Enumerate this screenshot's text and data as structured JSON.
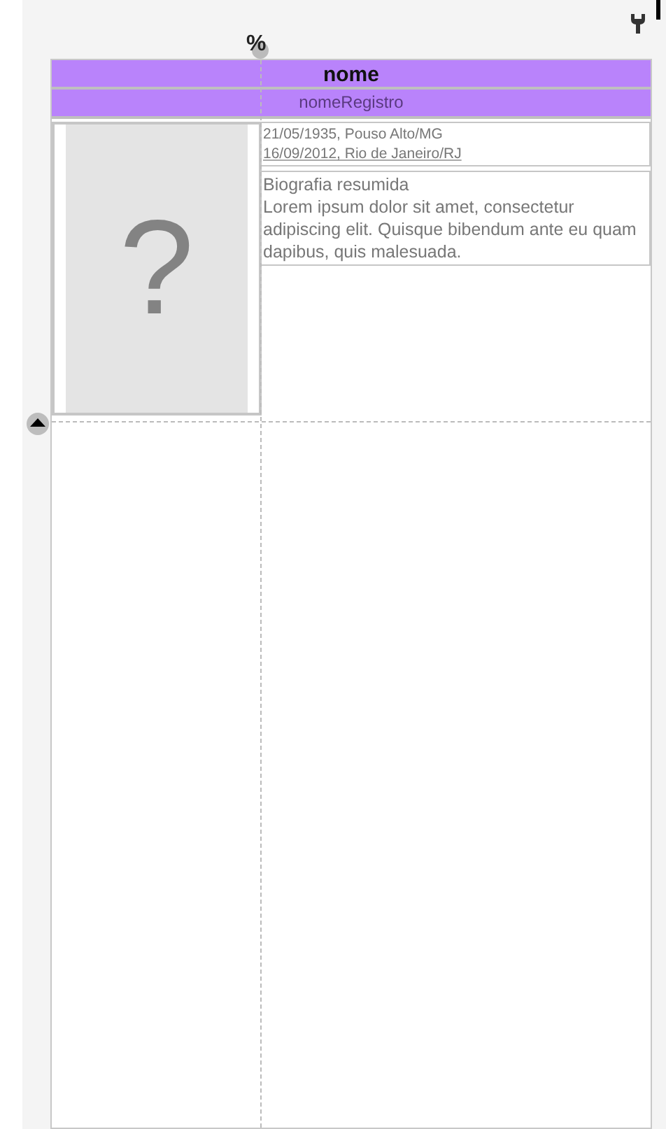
{
  "toolbar": {
    "percent_label": "%"
  },
  "header": {
    "title": "nome",
    "subtitle": "nomeRegistro"
  },
  "photo": {
    "placeholder_symbol": "?"
  },
  "dates": [
    "21/05/1935, Pouso Alto/MG",
    "16/09/2012, Rio de Janeiro/RJ"
  ],
  "bio": {
    "title": "Biografia resumida",
    "text": "Lorem ipsum dolor sit amet, consectetur adipiscing elit. Quisque bibendum ante eu quam dapibus, quis malesuada."
  }
}
